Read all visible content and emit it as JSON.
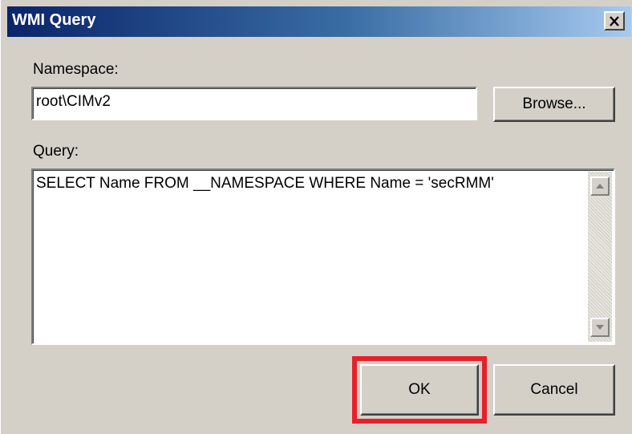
{
  "window": {
    "title": "WMI Query",
    "close_icon": "close-x-icon"
  },
  "namespace": {
    "label": "Namespace:",
    "value": "root\\CIMv2",
    "browse_label": "Browse..."
  },
  "query": {
    "label": "Query:",
    "value": "SELECT Name FROM __NAMESPACE WHERE Name = 'secRMM'",
    "scroll_up_icon": "scroll-up-arrow-icon",
    "scroll_down_icon": "scroll-down-arrow-icon"
  },
  "buttons": {
    "ok_label": "OK",
    "cancel_label": "Cancel"
  },
  "annotation": {
    "highlight_color": "#e8202a",
    "highlight_target": "OK"
  }
}
